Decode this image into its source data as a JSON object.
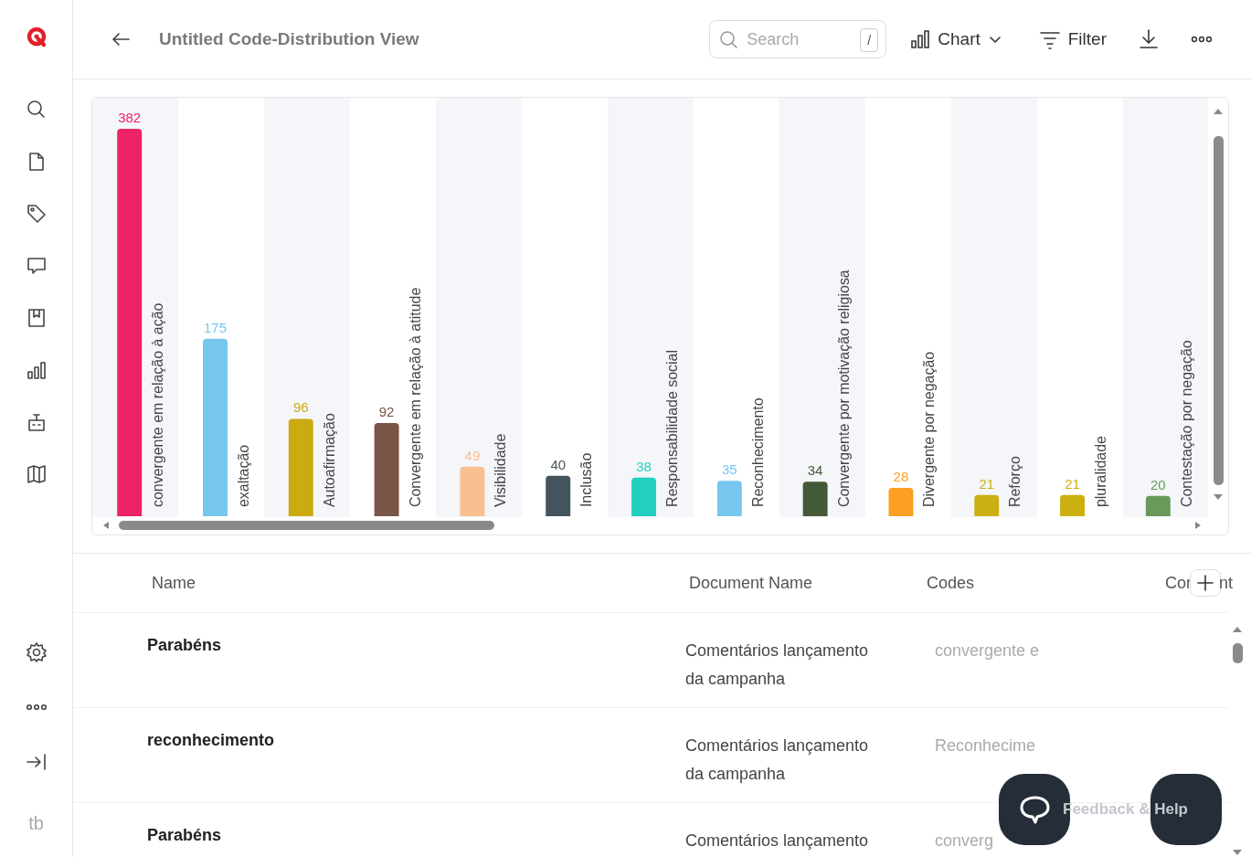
{
  "sidebar": {
    "user_initials": "tb"
  },
  "header": {
    "title": "Untitled Code-Distribution View",
    "search": {
      "placeholder": "Search",
      "shortcut": "/"
    },
    "view_menu": "Chart",
    "filter": "Filter"
  },
  "chart": {
    "chart_data": {
      "type": "bar",
      "orientation": "vertical",
      "data_labels": true,
      "categories": [
        "convergente em relação à ação",
        "exaltação",
        "Autoafirmação",
        "Convergente em relação à atitude",
        "Visibilidade",
        "Inclusão",
        "Responsabilidade social",
        "Reconhecimento",
        "Convergente por motivação religiosa",
        "Divergente por negação",
        "Reforço",
        "pluralidade",
        "Contestação por negação"
      ],
      "series": [
        {
          "values": [
            382,
            175,
            96,
            92,
            49,
            40,
            38,
            35,
            34,
            28,
            21,
            21,
            20
          ]
        }
      ],
      "colors": [
        "#ee2266",
        "#77c6ee",
        "#ccaa11",
        "#7a5444",
        "#fbbf8f",
        "#44545f",
        "#22d0c0",
        "#77c6ee",
        "#44593a",
        "#fba022",
        "#ccb011",
        "#ccb011",
        "#6a9a5a"
      ]
    }
  },
  "table": {
    "columns": [
      {
        "label": "Name"
      },
      {
        "label": "Document Name"
      },
      {
        "label": "Codes"
      },
      {
        "label_start": "Cor",
        "label_end": "nt"
      }
    ],
    "rows": [
      {
        "name": "Parabéns",
        "document": "Comentários lançamento da campanha",
        "codes": "convergente e"
      },
      {
        "name": "reconhecimento",
        "document": "Comentários lançamento da campanha",
        "codes": "Reconhecime"
      },
      {
        "name": "Parabéns",
        "document": "Comentários lançamento",
        "codes": "converg"
      }
    ]
  },
  "feedback": {
    "label": "Feedback & Help"
  }
}
